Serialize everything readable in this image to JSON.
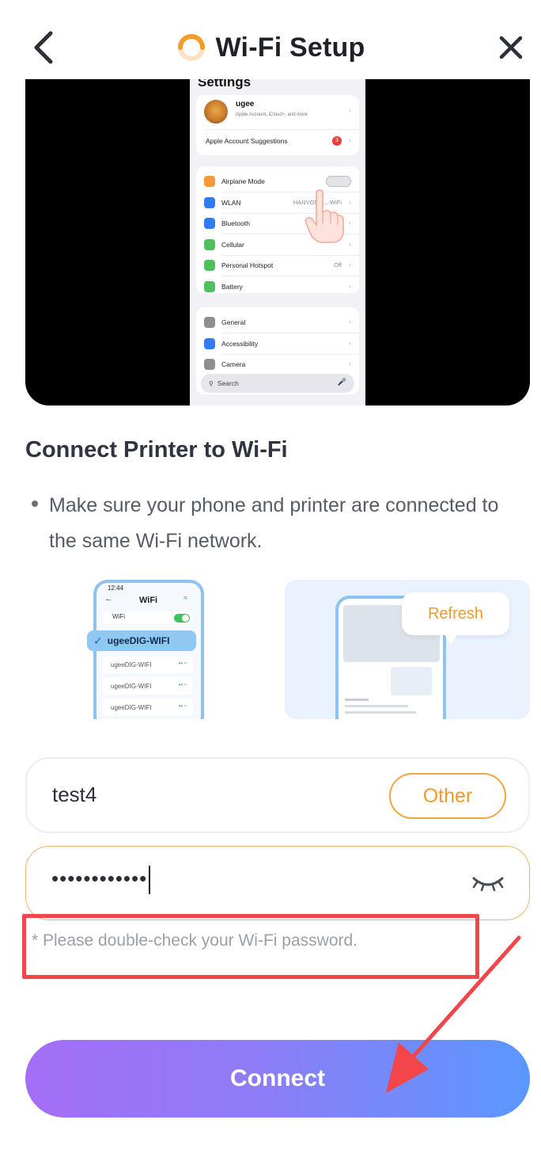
{
  "header": {
    "title": "Wi-Fi Setup",
    "back_icon": "chevron-left-icon",
    "close_icon": "close-icon",
    "logo_icon": "loading-ring-icon"
  },
  "video": {
    "settings_title": "Settings",
    "account_name": "ugee",
    "account_sub": "Apple Account, iCloud+, and more",
    "suggestions": "Apple Account Suggestions",
    "suggestions_badge": "3",
    "rows1": [
      {
        "label": "Airplane Mode",
        "value": "",
        "color": "#f59a37"
      },
      {
        "label": "WLAN",
        "value": "HANVONU...-WiFi",
        "color": "#2f7cf6"
      },
      {
        "label": "Bluetooth",
        "value": "",
        "color": "#2f7cf6"
      },
      {
        "label": "Cellular",
        "value": "",
        "color": "#4fc05b"
      },
      {
        "label": "Personal Hotspot",
        "value": "Off",
        "color": "#4fc05b"
      },
      {
        "label": "Battery",
        "value": "",
        "color": "#4fc05b"
      }
    ],
    "rows2": [
      {
        "label": "General",
        "color": "#8e8e93"
      },
      {
        "label": "Accessibility",
        "color": "#2f7cf6"
      },
      {
        "label": "Camera",
        "color": "#8e8e93"
      }
    ],
    "search_label": "Search"
  },
  "section": {
    "title": "Connect Printer to Wi-Fi",
    "bullet": "Make sure your phone and printer are connected to the same Wi-Fi network."
  },
  "illustration_left": {
    "time": "12:44",
    "screen_title": "WiFi",
    "wifi_label": "WiFi",
    "selected_network": "ugeeDIG-WIFI",
    "networks": [
      "ugeeDIG-WIFI",
      "ugeeDIG-WIFI",
      "ugeeDIG-WIFI"
    ]
  },
  "illustration_right": {
    "bubble": "Refresh"
  },
  "form": {
    "ssid": "test4",
    "other_label": "Other",
    "password_masked": "••••••••••••",
    "hint": "* Please double-check your Wi-Fi password.",
    "connect_label": "Connect"
  },
  "colors": {
    "accent_orange": "#ee9a30",
    "hint_border": "#f2464a",
    "button_gradient_start": "#a46ef7",
    "button_gradient_end": "#5a97ff"
  }
}
